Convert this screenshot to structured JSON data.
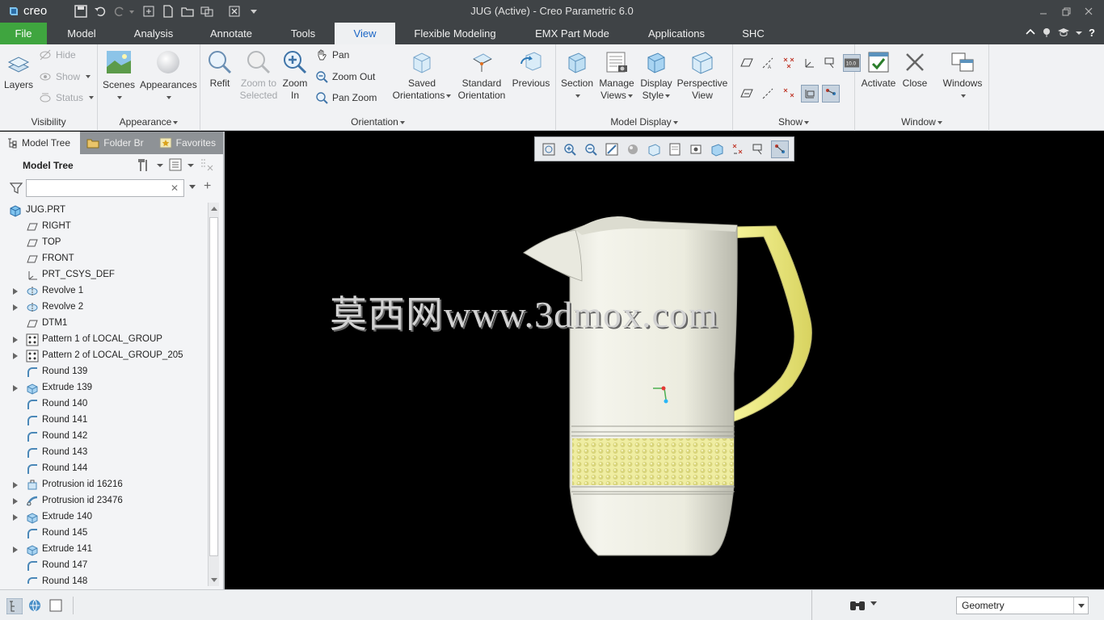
{
  "app": {
    "logo_text": "creo",
    "window_title": "JUG (Active) - Creo Parametric 6.0"
  },
  "tabs": [
    {
      "label": "File"
    },
    {
      "label": "Model"
    },
    {
      "label": "Analysis"
    },
    {
      "label": "Annotate"
    },
    {
      "label": "Tools"
    },
    {
      "label": "View"
    },
    {
      "label": "Flexible Modeling"
    },
    {
      "label": "EMX Part Mode"
    },
    {
      "label": "Applications"
    },
    {
      "label": "SHC"
    }
  ],
  "ribbon": {
    "visibility": {
      "label": "Visibility",
      "layers": "Layers",
      "hide": "Hide",
      "show": "Show",
      "status": "Status"
    },
    "appearance": {
      "label": "Appearance",
      "scenes": "Scenes",
      "appearances": "Appearances"
    },
    "orientation": {
      "label": "Orientation",
      "refit": "Refit",
      "zoom_selected_1": "Zoom to",
      "zoom_selected_2": "Selected",
      "zoom_in_1": "Zoom",
      "zoom_in_2": "In",
      "pan": "Pan",
      "zoom_out": "Zoom Out",
      "pan_zoom": "Pan Zoom",
      "saved_1": "Saved",
      "saved_2": "Orientations",
      "standard_1": "Standard",
      "standard_2": "Orientation",
      "previous": "Previous"
    },
    "model_display": {
      "label": "Model Display",
      "section": "Section",
      "manage_1": "Manage",
      "manage_2": "Views",
      "display_1": "Display",
      "display_2": "Style",
      "perspective_1": "Perspective",
      "perspective_2": "View"
    },
    "show": {
      "label": "Show",
      "csys_badge": "10.0"
    },
    "window": {
      "label": "Window",
      "activate": "Activate",
      "close": "Close",
      "windows": "Windows"
    }
  },
  "panel": {
    "tabs": [
      "Model Tree",
      "Folder Br",
      "Favorites"
    ],
    "tree_title": "Model Tree",
    "filter_value": "",
    "filter_placeholder": "",
    "items": [
      {
        "label": "JUG.PRT",
        "icon": "part-icon",
        "expand": false,
        "root": true
      },
      {
        "label": "RIGHT",
        "icon": "datum-plane-icon",
        "expand": false
      },
      {
        "label": "TOP",
        "icon": "datum-plane-icon",
        "expand": false
      },
      {
        "label": "FRONT",
        "icon": "datum-plane-icon",
        "expand": false
      },
      {
        "label": "PRT_CSYS_DEF",
        "icon": "csys-icon",
        "expand": false
      },
      {
        "label": "Revolve 1",
        "icon": "revolve-icon",
        "expand": true
      },
      {
        "label": "Revolve 2",
        "icon": "revolve-icon",
        "expand": true
      },
      {
        "label": "DTM1",
        "icon": "datum-plane-icon",
        "expand": false
      },
      {
        "label": "Pattern 1 of LOCAL_GROUP",
        "icon": "pattern-icon",
        "expand": true
      },
      {
        "label": "Pattern 2 of LOCAL_GROUP_205",
        "icon": "pattern-icon",
        "expand": true
      },
      {
        "label": "Round 139",
        "icon": "round-icon",
        "expand": false
      },
      {
        "label": "Extrude 139",
        "icon": "extrude-icon",
        "expand": true
      },
      {
        "label": "Round 140",
        "icon": "round-icon",
        "expand": false
      },
      {
        "label": "Round 141",
        "icon": "round-icon",
        "expand": false
      },
      {
        "label": "Round 142",
        "icon": "round-icon",
        "expand": false
      },
      {
        "label": "Round 143",
        "icon": "round-icon",
        "expand": false
      },
      {
        "label": "Round 144",
        "icon": "round-icon",
        "expand": false
      },
      {
        "label": "Protrusion id 16216",
        "icon": "protrusion-icon",
        "expand": true
      },
      {
        "label": "Protrusion id 23476",
        "icon": "protrusion-sweep-icon",
        "expand": true
      },
      {
        "label": "Extrude 140",
        "icon": "extrude-icon",
        "expand": true
      },
      {
        "label": "Round 145",
        "icon": "round-icon",
        "expand": false
      },
      {
        "label": "Extrude 141",
        "icon": "extrude-icon",
        "expand": true
      },
      {
        "label": "Round 147",
        "icon": "round-icon",
        "expand": false
      },
      {
        "label": "Round 148",
        "icon": "round-icon",
        "expand": false
      }
    ]
  },
  "viewport": {
    "watermark": "莫西网www.3dmox.com",
    "background": "#000000",
    "model_color": "#f0f0e6",
    "accent_color": "#f2ef8a"
  },
  "statusbar": {
    "filter_value": "Geometry"
  },
  "colors": {
    "file_tab": "#3fa53f",
    "active_tab_text": "#1b66c6",
    "title_bar": "#3f4346"
  }
}
